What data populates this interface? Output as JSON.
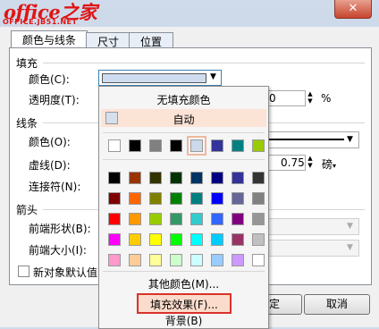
{
  "window": {
    "close_glyph": "✕",
    "watermark_main": "office之家",
    "watermark_sub": "OFFICE.JB51.NET"
  },
  "tabs": [
    {
      "label": "颜色与线条",
      "active": true
    },
    {
      "label": "尺寸",
      "active": false
    },
    {
      "label": "位置",
      "active": false
    }
  ],
  "fill": {
    "section_label": "填充",
    "color_label": "颜色(C):",
    "transparency_label": "透明度(T):",
    "transparency_value": "0",
    "transparency_unit": "%",
    "selected_color": "#cfdcef"
  },
  "line": {
    "section_label": "线条",
    "color_label": "颜色(O):",
    "dash_label": "虚线(D):",
    "connector_label": "连接符(N):",
    "weight_value": "0.75",
    "weight_unit": "磅"
  },
  "arrows": {
    "section_label": "箭头",
    "front_style_label": "前端形状(B):",
    "front_size_label": "前端大小(I):"
  },
  "default_checkbox_label": "新对象默认值",
  "buttons": {
    "ok": "确定",
    "cancel": "取消"
  },
  "color_popup": {
    "no_fill": "无填充颜色",
    "automatic": "自动",
    "automatic_color": "#d6e0ec",
    "recent_colors": [
      "#ffffff",
      "#000000",
      "#808080",
      "#000000",
      "#ccd9eb",
      "#333399",
      "#008080",
      "#99cc00"
    ],
    "palette": [
      [
        "#000000",
        "#993300",
        "#333300",
        "#003300",
        "#003366",
        "#000080",
        "#333399",
        "#333333"
      ],
      [
        "#800000",
        "#ff6600",
        "#808000",
        "#008000",
        "#008080",
        "#0000ff",
        "#666699",
        "#808080"
      ],
      [
        "#ff0000",
        "#ff9900",
        "#99cc00",
        "#339966",
        "#33cccc",
        "#3366ff",
        "#800080",
        "#969696"
      ],
      [
        "#ff00ff",
        "#ffcc00",
        "#ffff00",
        "#00ff00",
        "#00ffff",
        "#00ccff",
        "#993366",
        "#c0c0c0"
      ],
      [
        "#ff99cc",
        "#ffcc99",
        "#ffff99",
        "#ccffcc",
        "#ccffff",
        "#99ccff",
        "#cc99ff",
        "#ffffff"
      ]
    ],
    "more_colors": "其他颜色(M)...",
    "fill_effects": "填充效果(F)...",
    "background": "背景(B)"
  },
  "colors": {
    "highlight": "#d8332a"
  }
}
